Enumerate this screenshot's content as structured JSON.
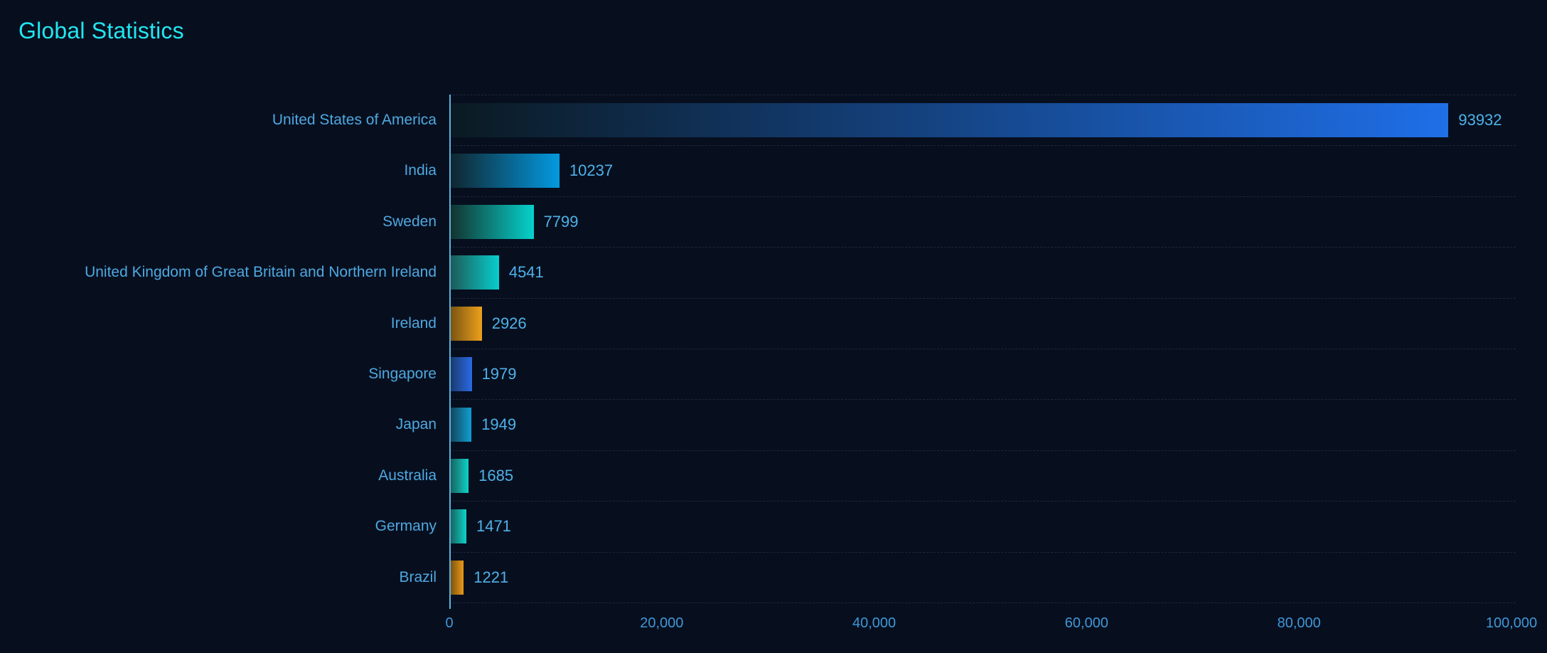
{
  "title": "Global Statistics",
  "theme": {
    "background": "#070f1f",
    "title_color": "#22e6f0",
    "label_color": "#4fa8e0",
    "value_color": "#4fb2e8",
    "axis_color": "#63c2ef",
    "gridline_color": "rgba(150,175,205,0.16)"
  },
  "chart_data": {
    "type": "bar",
    "orientation": "horizontal",
    "title": "Global Statistics",
    "xlabel": "",
    "ylabel": "",
    "xlim": [
      0,
      100000
    ],
    "grid": "horizontal-dashed",
    "legend": "none",
    "categories": [
      "United States of America",
      "India",
      "Sweden",
      "United Kingdom of Great Britain and Northern Ireland",
      "Ireland",
      "Singapore",
      "Japan",
      "Australia",
      "Germany",
      "Brazil"
    ],
    "values": [
      93932,
      10237,
      7799,
      4541,
      2926,
      1979,
      1949,
      1685,
      1471,
      1221
    ],
    "value_labels": [
      "93932",
      "10237",
      "7799",
      "4541",
      "2926",
      "1979",
      "1949",
      "1685",
      "1471",
      "1221"
    ],
    "bar_colors": [
      {
        "from": "#0b1a22",
        "to": "#1f6fe8"
      },
      {
        "from": "#10262f",
        "to": "#039ae0"
      },
      {
        "from": "#13332f",
        "to": "#06d2cc"
      },
      {
        "from": "#1d5a58",
        "to": "#07cfcd"
      },
      {
        "from": "#7a5412",
        "to": "#eda01c"
      },
      {
        "from": "#1b3a6e",
        "to": "#2a6ae6"
      },
      {
        "from": "#15455c",
        "to": "#109fd2"
      },
      {
        "from": "#18635f",
        "to": "#0ed3c9"
      },
      {
        "from": "#18635f",
        "to": "#0ed3c9"
      },
      {
        "from": "#7c5311",
        "to": "#e99a17"
      }
    ],
    "xticks": [
      0,
      20000,
      40000,
      60000,
      80000,
      100000
    ],
    "xtick_labels": [
      "0",
      "20,000",
      "40,000",
      "60,000",
      "80,000",
      "100,000"
    ]
  }
}
